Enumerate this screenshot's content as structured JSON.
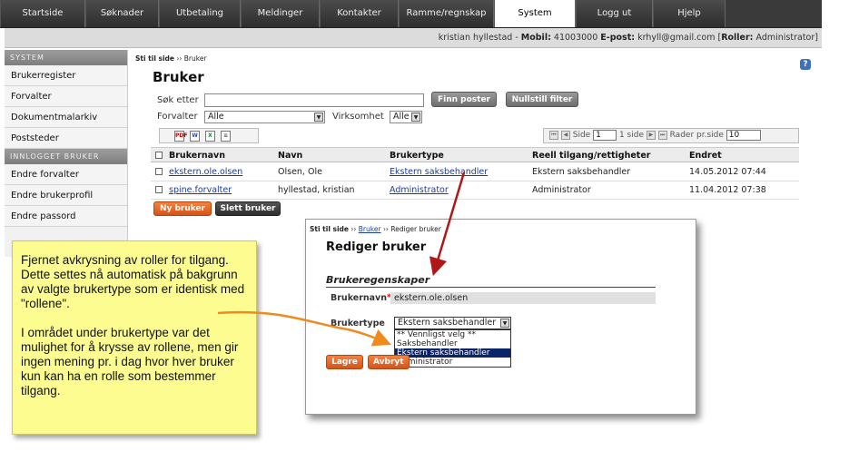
{
  "nav": {
    "tabs": [
      "Startside",
      "Søknader",
      "Utbetaling",
      "Meldinger",
      "Kontakter",
      "Ramme/regnskap",
      "System",
      "Logg ut",
      "Hjelp"
    ],
    "active": "System"
  },
  "userbar": {
    "name": "kristian hyllestad",
    "mobil_label": "Mobil:",
    "mobil": "41003000",
    "epost_label": "E-post:",
    "epost": "krhyll@gmail.com",
    "roller_label": "Roller:",
    "roller": "Administrator"
  },
  "sidebar": {
    "system_head": "SYSTEM",
    "system_items": [
      "Brukerregister",
      "Forvalter",
      "Dokumentmalarkiv",
      "Poststeder"
    ],
    "user_head": "INNLOGGET BRUKER",
    "user_items": [
      "Endre forvalter",
      "Endre brukerprofil",
      "Endre passord"
    ]
  },
  "breadcrumb": {
    "root": "Sti til side",
    "sep": "››",
    "current": "Bruker"
  },
  "page": {
    "title": "Bruker"
  },
  "search": {
    "sok_label": "Søk etter",
    "sok_value": "",
    "forvalter_label": "Forvalter",
    "forvalter_value": "Alle",
    "virksomhet_label": "Virksomhet",
    "virksomhet_value": "Alle",
    "find_button": "Finn poster",
    "reset_button": "Nullstill filter"
  },
  "export_icons": [
    "pdf-icon",
    "word-icon",
    "excel-icon",
    "csv-icon"
  ],
  "pager": {
    "side_label": "Side",
    "page": "1",
    "total": "1 side",
    "rows_label": "Rader pr.side",
    "rows": "10"
  },
  "table": {
    "headers": [
      "Brukernavn",
      "Navn",
      "Brukertype",
      "Reell tilgang/rettigheter",
      "Endret"
    ],
    "rows": [
      {
        "brukernavn": "ekstern.ole.olsen",
        "navn": "Olsen, Ole",
        "brukertype": "Ekstern saksbehandler",
        "tilgang": "Ekstern saksbehandler",
        "endret": "14.05.2012 07:44"
      },
      {
        "brukernavn": "spine.forvalter",
        "navn": "hyllestad, kristian",
        "brukertype": "Administrator",
        "tilgang": "Administrator",
        "endret": "11.04.2012 07:38"
      }
    ]
  },
  "actions": {
    "new": "Ny bruker",
    "delete": "Slett bruker"
  },
  "popup": {
    "breadcrumb": {
      "root": "Sti til side",
      "sep1": "››",
      "mid": "Bruker",
      "sep2": "››",
      "current": "Rediger bruker"
    },
    "title": "Rediger bruker",
    "section": "Brukeregenskaper",
    "brukernavn_label": "Brukernavn",
    "required_mark": "*",
    "brukernavn_value": "ekstern.ole.olsen",
    "brukertype_label": "Brukertype",
    "brukertype_value": "Ekstern saksbehandler",
    "options": [
      "** Vennligst velg **",
      "Saksbehandler",
      "Ekstern saksbehandler",
      "Administrator"
    ],
    "selected_option": "Ekstern saksbehandler",
    "save": "Lagre",
    "cancel": "Avbryt"
  },
  "note": {
    "p1": "Fjernet avkrysning av roller for tilgang. Dette settes nå automatisk på bakgrunn av valgte brukertype som er identisk med \"rollene\".",
    "p2": "I området under brukertype var det mulighet for å krysse av rollene, men gir ingen mening pr. i dag hvor hver bruker kun kan ha en rolle som bestemmer tilgang."
  },
  "colors": {
    "nav_bg": "#3a3a3a",
    "accent_orange": "#e0662a",
    "link": "#1b3d9a",
    "note_bg": "#fcfc91",
    "arrow_red": "#b01818",
    "arrow_orange": "#f08a1c"
  }
}
